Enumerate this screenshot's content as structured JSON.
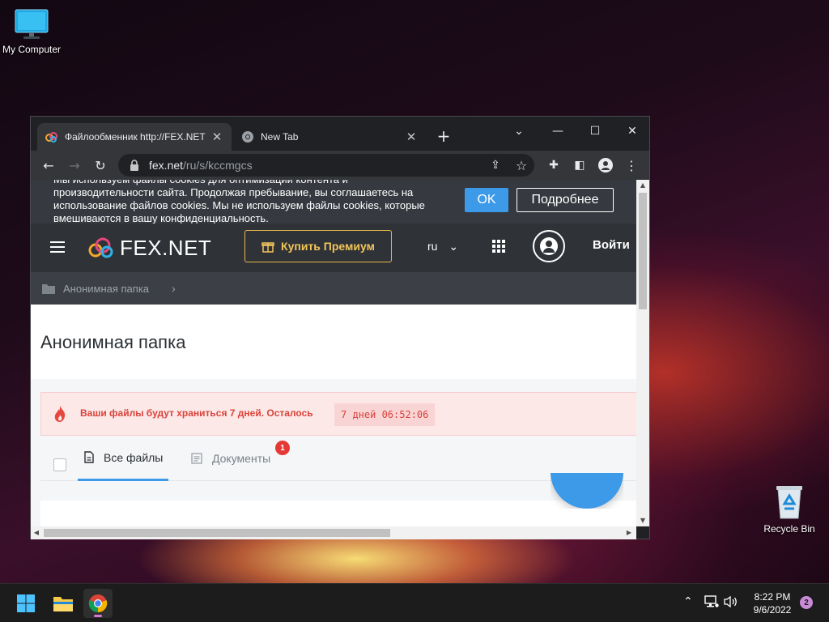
{
  "desktop": {
    "my_computer": "My Computer",
    "recycle_bin": "Recycle Bin"
  },
  "browser": {
    "tabs": [
      {
        "title": "Файлообменник http://FEX.NET"
      },
      {
        "title": "New Tab"
      }
    ],
    "address": {
      "host": "fex.net",
      "path": "/ru/s/kccmgcs"
    }
  },
  "site": {
    "cookie_notice": {
      "text": "Мы используем файлы cookies для оптимизации контента и производительности сайта. Продолжая пребывание, вы соглашаетесь на использование файлов cookies. Мы не используем файлы cookies, которые вмешиваются в вашу конфиденциальность.",
      "ok_label": "OK",
      "more_label": "Подробнее"
    },
    "header": {
      "logo_text": "FEX.NET",
      "premium_label": "Купить Премиум",
      "language": "ru",
      "login_label": "Войти"
    },
    "breadcrumb": {
      "folder": "Анонимная папка"
    },
    "page_title": "Анонимная папка",
    "storage_warning": {
      "text": "Ваши файлы будут храниться 7 дней. Осталось",
      "timer": "7 дней  06:52:06"
    },
    "file_tabs": [
      {
        "label": "Все файлы"
      },
      {
        "label": "Документы",
        "badge": "1"
      }
    ],
    "colors": {
      "accent": "#3d9ae8",
      "warning": "#d9433a",
      "premium": "#f2c45a"
    }
  },
  "taskbar": {
    "time": "8:22 PM",
    "date": "9/6/2022",
    "notifications": "2"
  }
}
